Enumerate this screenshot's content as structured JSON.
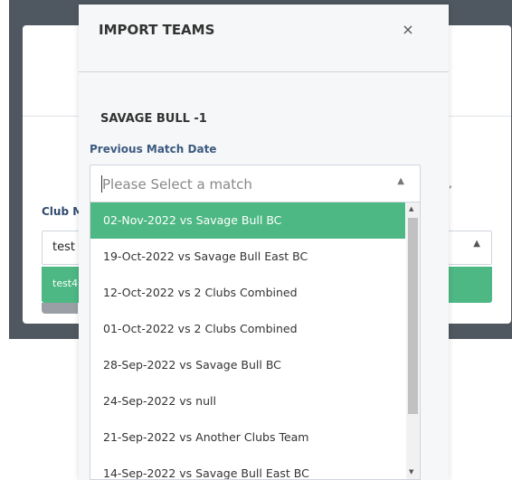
{
  "background": {
    "field_label": "Club M",
    "select_value": "test",
    "option_text": "test4",
    "caret_icon": "caret-up-icon"
  },
  "modal": {
    "title": "IMPORT TEAMS",
    "close_label": "×",
    "team_name": "SAVAGE BULL -1",
    "field_label": "Previous Match Date",
    "select": {
      "placeholder": "Please Select a match",
      "caret_icon": "caret-up-icon"
    },
    "options": [
      "02-Nov-2022 vs Savage Bull BC",
      "19-Oct-2022 vs Savage Bull East BC",
      "12-Oct-2022 vs 2 Clubs Combined",
      "01-Oct-2022 vs 2 Clubs Combined",
      "28-Sep-2022 vs Savage Bull BC",
      "24-Sep-2022 vs null",
      "21-Sep-2022 vs Another Clubs Team",
      "14-Sep-2022 vs Savage Bull East BC"
    ],
    "selected_index": 0
  },
  "colors": {
    "accent": "#4db883",
    "backdrop": "#4f5760",
    "label": "#3c5a80"
  }
}
